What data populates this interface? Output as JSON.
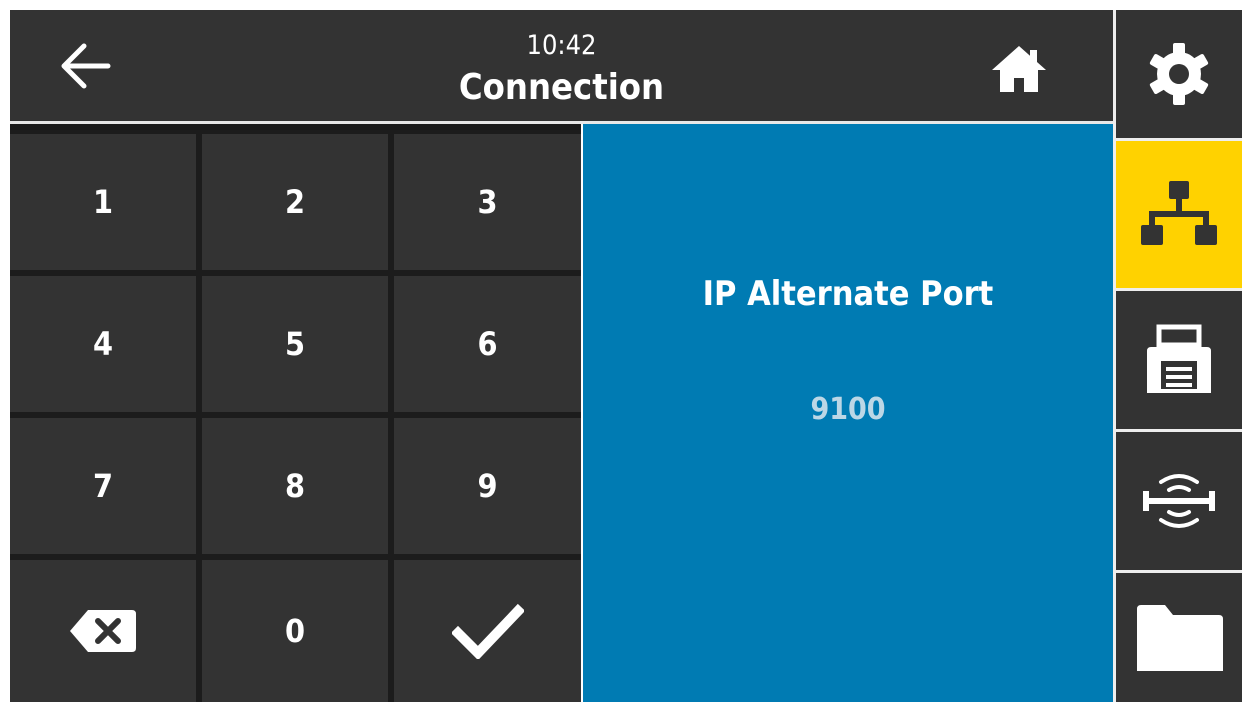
{
  "header": {
    "time": "10:42",
    "title": "Connection",
    "back_icon": "arrow-left-icon",
    "home_icon": "home-icon"
  },
  "keypad": {
    "keys": [
      "1",
      "2",
      "3",
      "4",
      "5",
      "6",
      "7",
      "8",
      "9",
      "0"
    ],
    "backspace_icon": "backspace-icon",
    "confirm_icon": "checkmark-icon"
  },
  "field": {
    "label": "IP Alternate Port",
    "value": "9100"
  },
  "sidebar": {
    "items": [
      {
        "icon": "gear-icon",
        "active": false
      },
      {
        "icon": "network-icon",
        "active": true
      },
      {
        "icon": "printer-icon",
        "active": false
      },
      {
        "icon": "rfid-icon",
        "active": false
      },
      {
        "icon": "folder-icon",
        "active": false
      }
    ]
  },
  "colors": {
    "header_bg": "#333333",
    "panel_bg": "#007bb3",
    "active_tab": "#ffd200",
    "value_text": "#bcd7e6"
  }
}
